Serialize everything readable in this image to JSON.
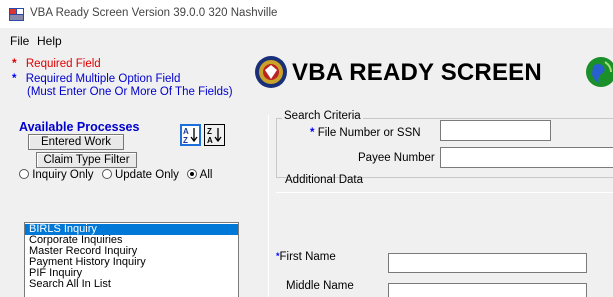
{
  "window": {
    "title": "VBA Ready Screen Version 39.0.0  320 Nashville"
  },
  "menu": {
    "items": [
      "File",
      "Help"
    ]
  },
  "legend": {
    "required_star": "*",
    "required_label": "Required Field",
    "multi_star": "*",
    "multi_label_line1": "Required Multiple Option Field",
    "multi_label_line2": "(Must Enter One Or More Of The Fields)"
  },
  "banner": {
    "title": "VBA READY SCREEN"
  },
  "processes": {
    "title": "Available Processes",
    "entered_work_label": "Entered Work",
    "claim_type_filter_label": "Claim Type Filter",
    "sort_az_label": "A↓Z",
    "sort_za_label": "Z↓A",
    "radio_inquiry_label": "Inquiry Only",
    "radio_update_label": "Update Only",
    "radio_all_label": "All",
    "selected_radio": "All",
    "list": [
      "BIRLS Inquiry",
      "Corporate Inquiries",
      "Master Record Inquiry",
      "Payment History Inquiry",
      "PIF Inquiry",
      "Search All In List"
    ],
    "selected_index": 0
  },
  "search": {
    "group_label": "Search Criteria",
    "file_number_star": "*",
    "file_number_label": "File Number or SSN",
    "file_number_value": "",
    "payee_label": "Payee Number",
    "payee_value": "",
    "additional_label": "Additional Data",
    "first_name_star": "*",
    "first_name_label": "First Name",
    "first_name_value": "",
    "middle_name_label": "Middle Name",
    "middle_name_value": ""
  },
  "colors": {
    "required_red": "#e00000",
    "multi_blue": "#0000cc",
    "selection_blue": "#0078d7"
  },
  "icons": {
    "app": "vba-app-icon",
    "seal": "va-seal-icon",
    "globe": "globe-icon"
  }
}
